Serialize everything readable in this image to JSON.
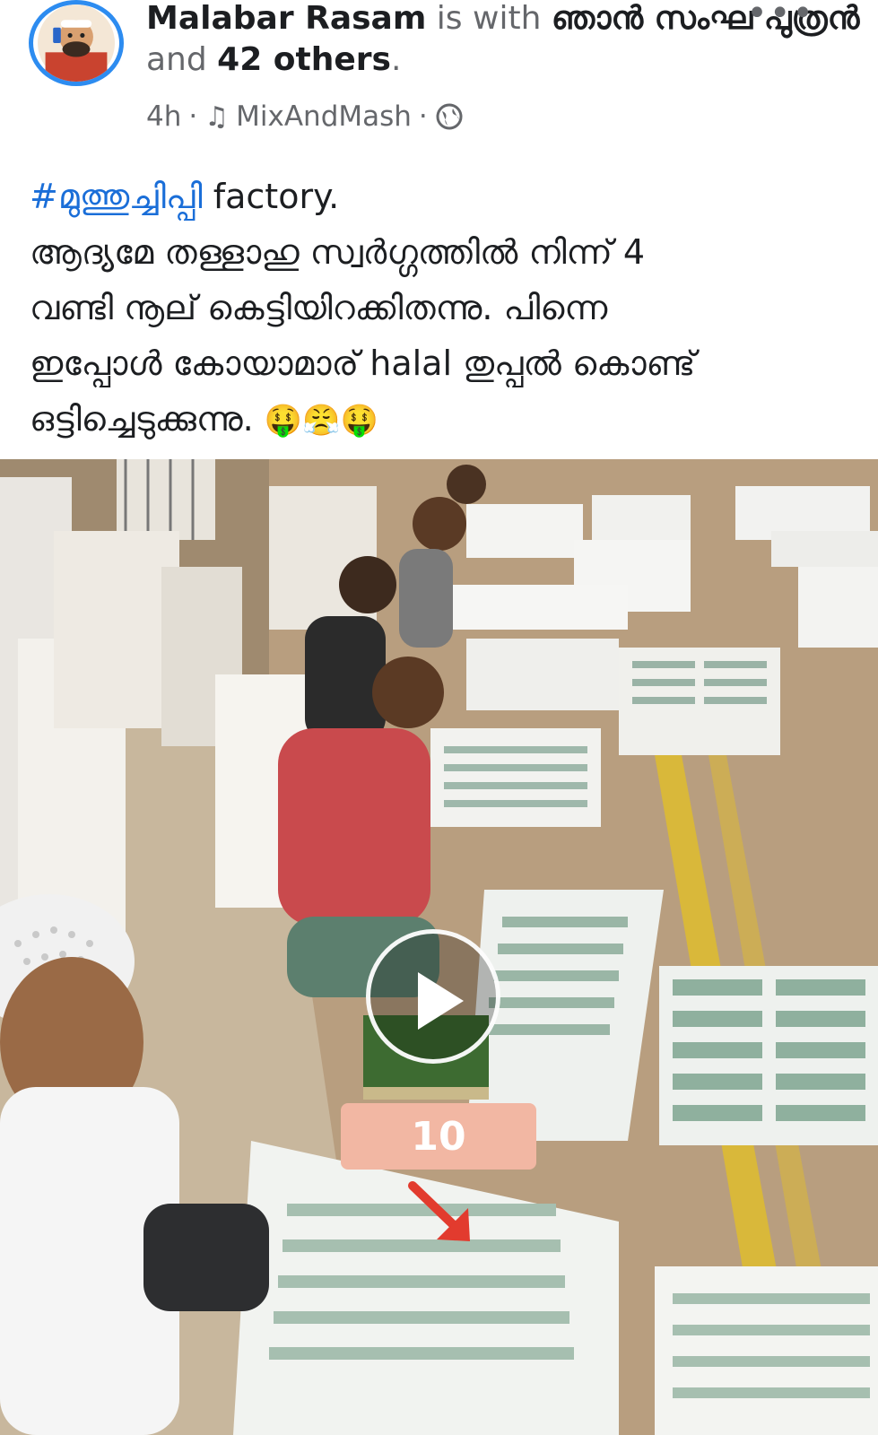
{
  "post": {
    "author": "Malabar Rasam",
    "with_text": " is with ",
    "tagged_primary": "ഞാൻ സംഘ പുത്രൻ",
    "and_text": " and ",
    "others": "42 others",
    "period": ".",
    "time": "4h",
    "sep1": "·",
    "music_label": "MixAndMash",
    "sep2": "·",
    "audience_icon": "globe-icon",
    "more_label": "•••"
  },
  "body": {
    "hashtag": "#മുത്തുച്ചിപ്പി",
    "line1_rest": " factory.",
    "line2": "ആദ്യമേ തള്ളാഹു സ്വർഗ്ഗത്തിൽ നിന്ന് 4",
    "line3": "വണ്ടി നൂല് കെട്ടിയിറക്കിതന്നു. പിന്നെ",
    "line4": "ഇപ്പോൾ കോയാമാര് halal തുപ്പൽ കൊണ്ട്",
    "line5": "ഒട്ടിച്ചെടുക്കുന്നു.",
    "emojis": "🤑😤🤑"
  },
  "video": {
    "counter": "10",
    "play_icon": "play-icon",
    "arrow_icon": "red-arrow-icon"
  },
  "colors": {
    "accent": "#1a6ed8",
    "avatar_ring": "#2d8cf0",
    "badge": "#f2b7a3",
    "arrow": "#e23b2e"
  }
}
